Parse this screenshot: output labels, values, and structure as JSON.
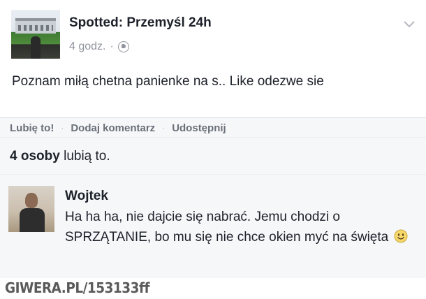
{
  "post": {
    "page_name": "Spotted: Przemyśl 24h",
    "time": "4 godz.",
    "meta_separator": "·",
    "privacy_icon": "globe-icon",
    "menu_icon": "chevron-down-icon",
    "text": "Poznam miłą chetna panienke na s.. Like odezwe sie"
  },
  "actions": {
    "like": "Lubię to!",
    "comment": "Dodaj komentarz",
    "share": "Udostępnij",
    "separator": "·"
  },
  "likes": {
    "count": "4 osoby",
    "suffix": " lubią to."
  },
  "comment": {
    "author": "Wojtek",
    "text": "Ha ha ha, nie dajcie się nabrać. Jemu chodzi o SPRZĄTANIE, bo mu się nie chce okien myć na święta",
    "emoji_icon": "smiley-icon"
  },
  "watermark": "GIWERA.PL/153133ff",
  "colors": {
    "text": "#1d2129",
    "secondary": "#90949c",
    "panel": "#f6f7f9",
    "border": "#dddfe2"
  }
}
